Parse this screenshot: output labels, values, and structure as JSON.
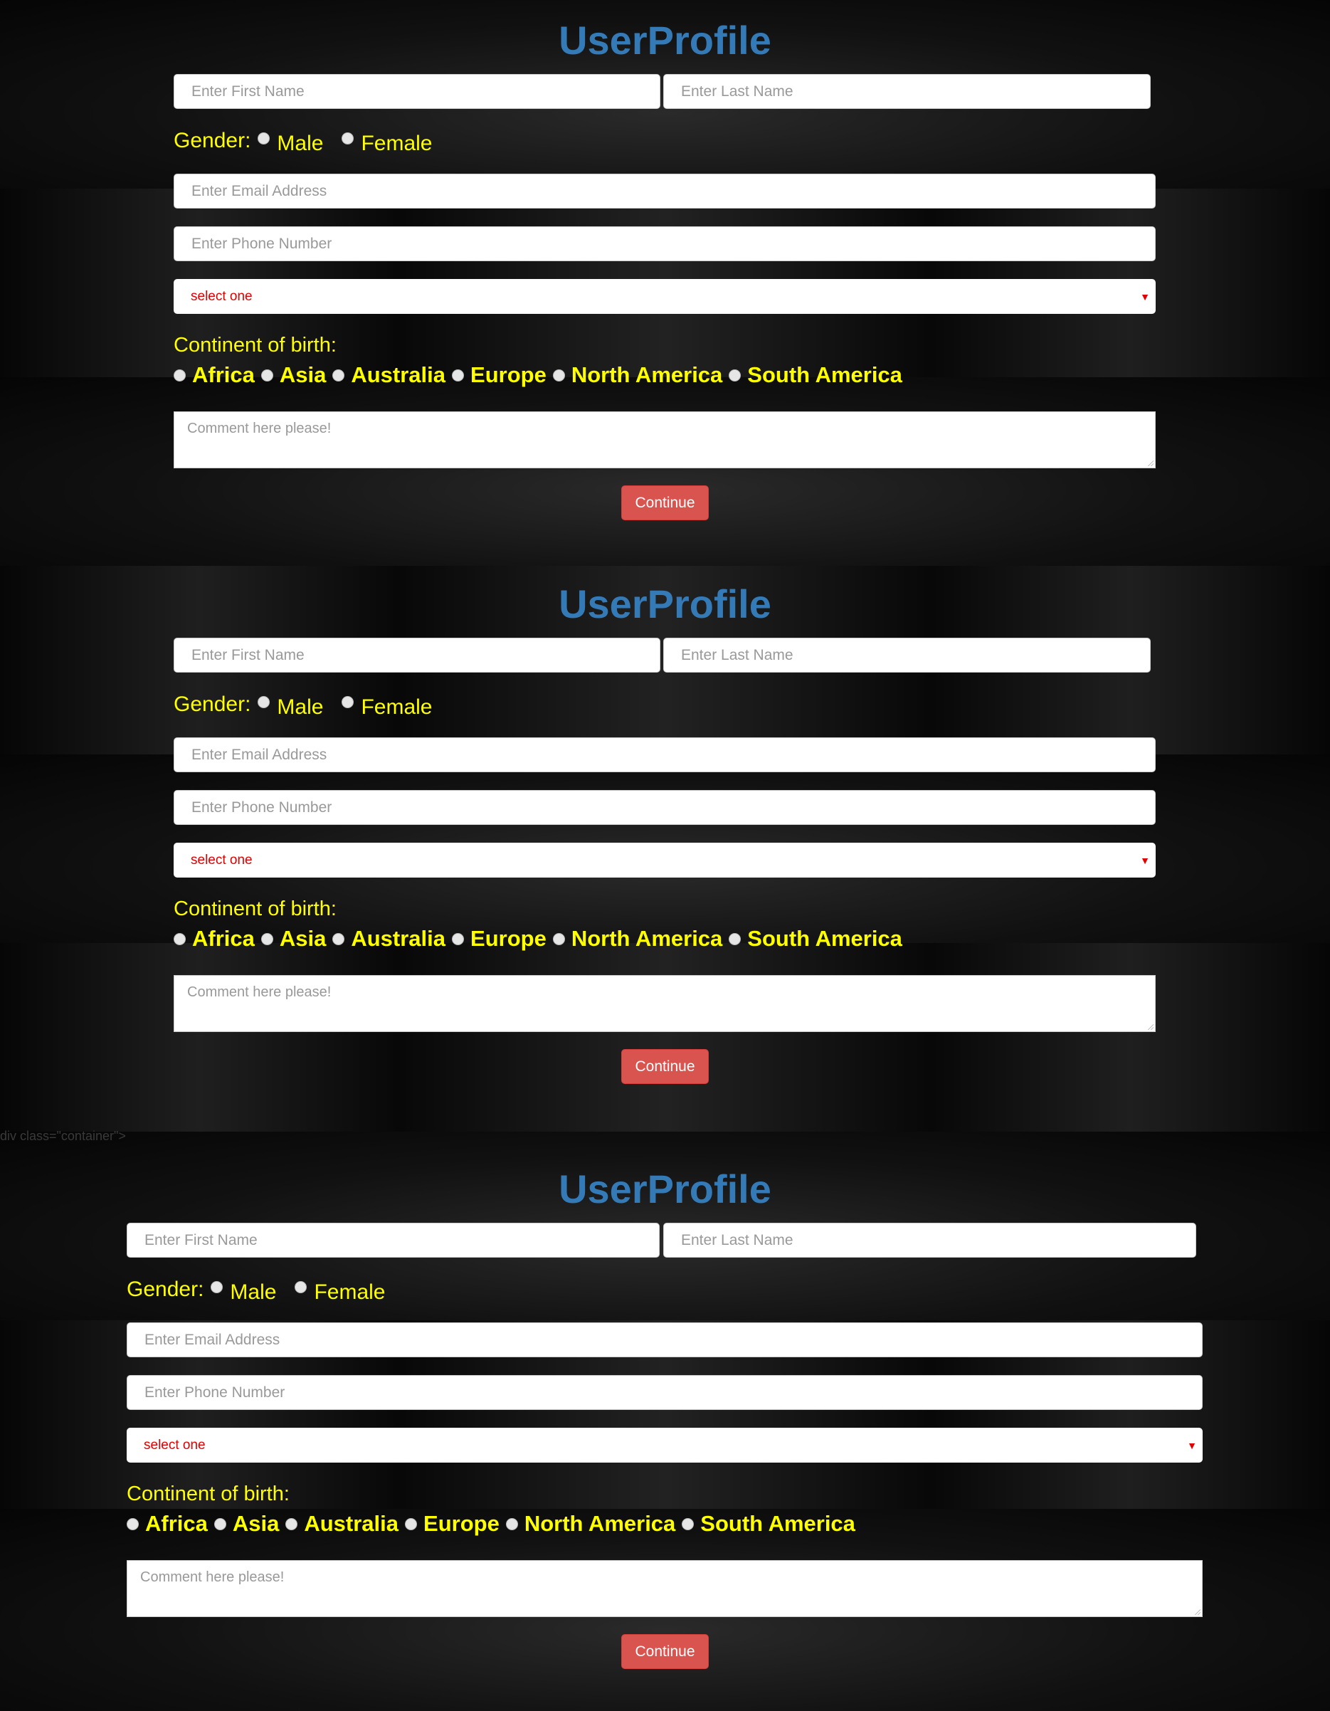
{
  "stray_text": "div class=\"container\">",
  "forms": [
    {
      "title": "UserProfile",
      "first_name_placeholder": "Enter First Name",
      "last_name_placeholder": "Enter Last Name",
      "gender_label": "Gender:",
      "gender_options": [
        "Male",
        "Female"
      ],
      "email_placeholder": "Enter Email Address",
      "phone_placeholder": "Enter Phone Number",
      "select_value": "select one",
      "continent_label": "Continent of birth:",
      "continents": [
        "Africa",
        "Asia",
        "Australia",
        "Europe",
        "North America",
        "South America"
      ],
      "comment_placeholder": "Comment here please!",
      "button_label": "Continue"
    },
    {
      "title": "UserProfile",
      "first_name_placeholder": "Enter First Name",
      "last_name_placeholder": "Enter Last Name",
      "gender_label": "Gender:",
      "gender_options": [
        "Male",
        "Female"
      ],
      "email_placeholder": "Enter Email Address",
      "phone_placeholder": "Enter Phone Number",
      "select_value": "select one",
      "continent_label": "Continent of birth:",
      "continents": [
        "Africa",
        "Asia",
        "Australia",
        "Europe",
        "North America",
        "South America"
      ],
      "comment_placeholder": "Comment here please!",
      "button_label": "Continue"
    },
    {
      "title": "UserProfile",
      "first_name_placeholder": "Enter First Name",
      "last_name_placeholder": "Enter Last Name",
      "gender_label": "Gender:",
      "gender_options": [
        "Male",
        "Female"
      ],
      "email_placeholder": "Enter Email Address",
      "phone_placeholder": "Enter Phone Number",
      "select_value": "select one",
      "continent_label": "Continent of birth:",
      "continents": [
        "Africa",
        "Asia",
        "Australia",
        "Europe",
        "North America",
        "South America"
      ],
      "comment_placeholder": "Comment here please!",
      "button_label": "Continue"
    }
  ],
  "colors": {
    "title": "#337ab7",
    "label_yellow": "#ffff00",
    "select_red": "#e00000",
    "button": "#d9534f",
    "background": "#0b0b0b"
  }
}
